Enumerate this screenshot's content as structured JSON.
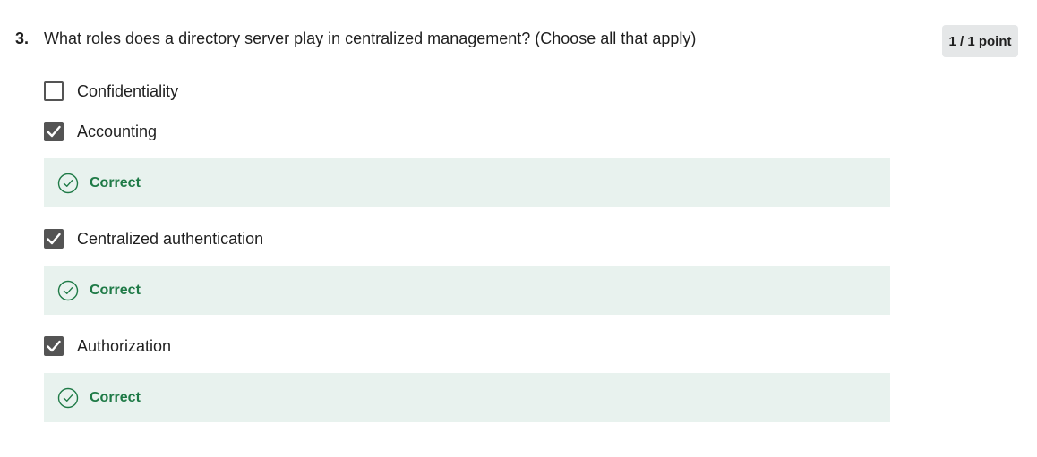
{
  "question": {
    "number": "3.",
    "text": "What roles does a directory server play in centralized management? (Choose all that apply)",
    "points": "1 / 1 point"
  },
  "options": [
    {
      "label": "Confidentiality",
      "checked": false
    },
    {
      "label": "Accounting",
      "checked": true,
      "feedback": "Correct"
    },
    {
      "label": "Centralized authentication",
      "checked": true,
      "feedback": "Correct"
    },
    {
      "label": "Authorization",
      "checked": true,
      "feedback": "Correct"
    }
  ],
  "colors": {
    "feedback_background": "#e8f2ee",
    "correct_green": "#1e7a46",
    "checkbox_fill": "#545454",
    "badge_background": "#e5e7e8"
  },
  "icons": {
    "checkmark": "checkmark-icon",
    "correct": "check-circle-icon"
  }
}
